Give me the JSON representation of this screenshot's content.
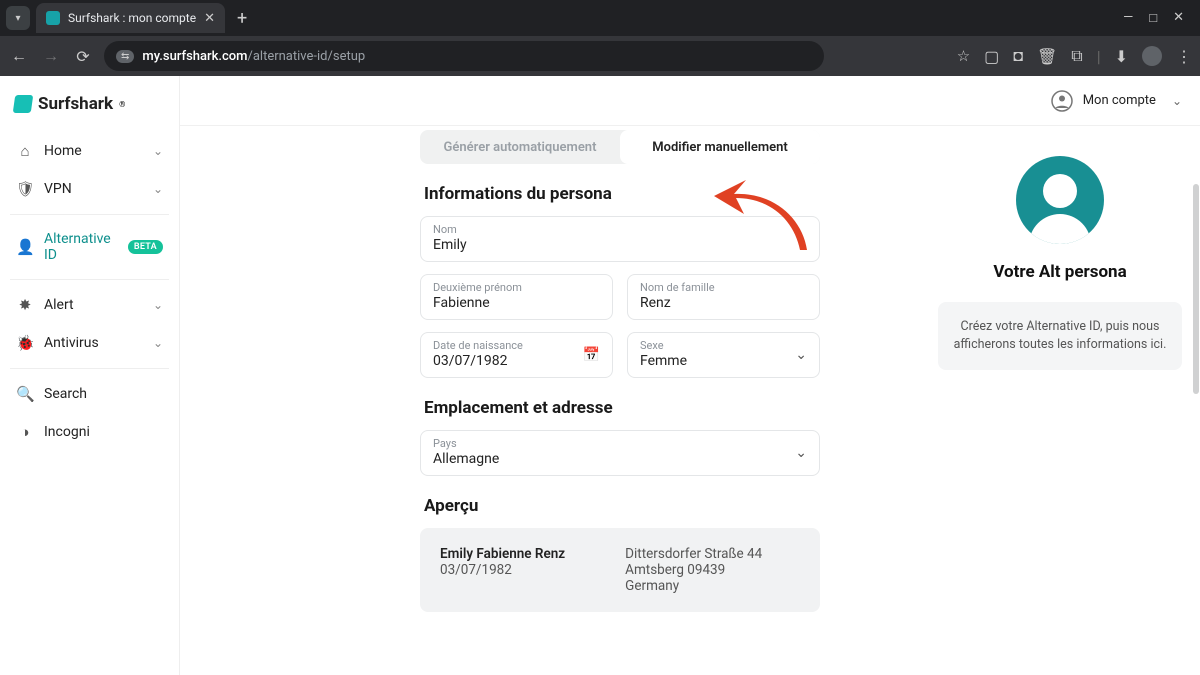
{
  "browser": {
    "tab_title": "Surfshark : mon compte",
    "url_host": "my.surfshark.com",
    "url_path": "/alternative-id/setup"
  },
  "logo": {
    "text": "Surfshark"
  },
  "account_menu": "Mon compte",
  "sidebar": {
    "items": [
      {
        "label": "Home",
        "icon": "⌂",
        "chev": true
      },
      {
        "label": "VPN",
        "icon": "🛡",
        "chev": true
      },
      {
        "label": "Alternative ID",
        "icon": "👤",
        "badge": "BETA",
        "active": true
      },
      {
        "label": "Alert",
        "icon": "✸",
        "chev": true
      },
      {
        "label": "Antivirus",
        "icon": "🐞",
        "chev": true
      },
      {
        "label": "Search",
        "icon": "🔍"
      },
      {
        "label": "Incogni",
        "icon": "◑"
      }
    ]
  },
  "tabs": {
    "auto": "Générer automatiquement",
    "manual": "Modifier manuellement"
  },
  "sections": {
    "persona": "Informations du persona",
    "location": "Emplacement et adresse",
    "preview": "Aperçu"
  },
  "fields": {
    "name_lbl": "Nom",
    "name_val": "Emily",
    "middle_lbl": "Deuxième prénom",
    "middle_val": "Fabienne",
    "last_lbl": "Nom de famille",
    "last_val": "Renz",
    "dob_lbl": "Date de naissance",
    "dob_val": "03/07/1982",
    "sex_lbl": "Sexe",
    "sex_val": "Femme",
    "country_lbl": "Pays",
    "country_val": "Allemagne"
  },
  "preview": {
    "name": "Emily Fabienne Renz",
    "dob": "03/07/1982",
    "street": "Dittersdorfer Straße 44",
    "city": "Amtsberg 09439",
    "country": "Germany"
  },
  "right": {
    "title": "Votre Alt persona",
    "msg": "Créez votre Alternative ID, puis nous afficherons toutes les informations ici."
  }
}
